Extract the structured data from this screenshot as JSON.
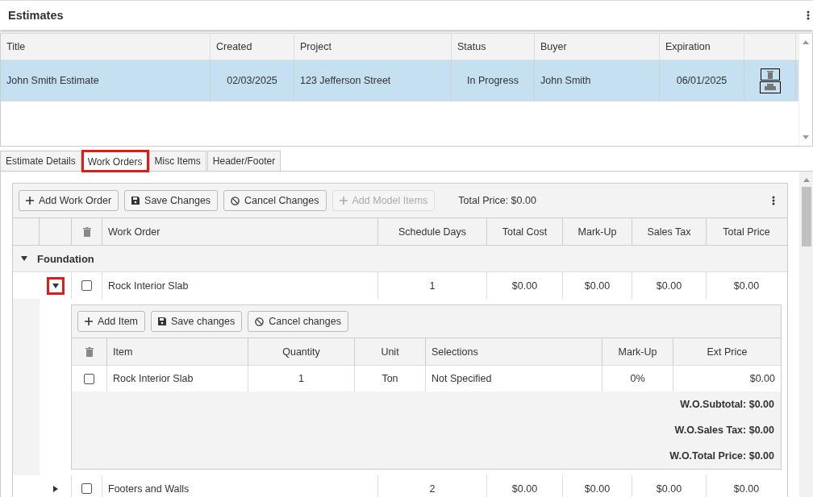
{
  "header": {
    "title": "Estimates"
  },
  "estimates": {
    "columns": [
      "Title",
      "Created",
      "Project",
      "Status",
      "Buyer",
      "Expiration"
    ],
    "rows": [
      {
        "title": "John Smith Estimate",
        "created": "02/03/2025",
        "project": "123 Jefferson Street",
        "status": "In Progress",
        "buyer": "John Smith",
        "expiration": "06/01/2025",
        "selected": true
      }
    ]
  },
  "tabs": [
    {
      "label": "Estimate Details",
      "selected": false,
      "highlighted": false
    },
    {
      "label": "Work Orders",
      "selected": true,
      "highlighted": true
    },
    {
      "label": "Misc Items",
      "selected": false,
      "highlighted": false
    },
    {
      "label": "Header/Footer",
      "selected": false,
      "highlighted": false
    }
  ],
  "work_orders": {
    "toolbar": [
      {
        "label": "Add Work Order",
        "kind": "add",
        "disabled": false
      },
      {
        "label": "Save Changes",
        "kind": "save",
        "disabled": false
      },
      {
        "label": "Cancel Changes",
        "kind": "cancel",
        "disabled": false
      },
      {
        "label": "Add Model Items",
        "kind": "add",
        "disabled": true
      }
    ],
    "total_price": "Total Price: $0.00",
    "columns": [
      "Work Order",
      "Schedule Days",
      "Total Cost",
      "Mark-Up",
      "Sales Tax",
      "Total Price"
    ],
    "groups": [
      {
        "name": "Foundation",
        "expanded": true,
        "orders": [
          {
            "name": "Rock Interior Slab",
            "checked": false,
            "expanded": true,
            "highlighted": true,
            "schedule_days": "1",
            "total_cost": "$0.00",
            "markup": "$0.00",
            "sales_tax": "$0.00",
            "total_price": "$0.00",
            "detail": {
              "toolbar": [
                {
                  "label": "Add Item",
                  "kind": "add"
                },
                {
                  "label": "Save changes",
                  "kind": "save"
                },
                {
                  "label": "Cancel changes",
                  "kind": "cancel"
                }
              ],
              "columns": [
                "Item",
                "Quantity",
                "Unit",
                "Selections",
                "Mark-Up",
                "Ext Price"
              ],
              "items": [
                {
                  "checked": false,
                  "item": "Rock Interior Slab",
                  "quantity": "1",
                  "unit": "Ton",
                  "selections": "Not Specified",
                  "markup": "0%",
                  "ext_price": "$0.00"
                }
              ],
              "totals": [
                "W.O.Subtotal: $0.00",
                "W.O.Sales Tax: $0.00",
                "W.O.Total Price: $0.00"
              ]
            }
          },
          {
            "name": "Footers and Walls",
            "checked": false,
            "expanded": false,
            "highlighted": false,
            "schedule_days": "2",
            "total_cost": "$0.00",
            "markup": "$0.00",
            "sales_tax": "$0.00",
            "total_price": "$0.00"
          }
        ]
      }
    ]
  }
}
